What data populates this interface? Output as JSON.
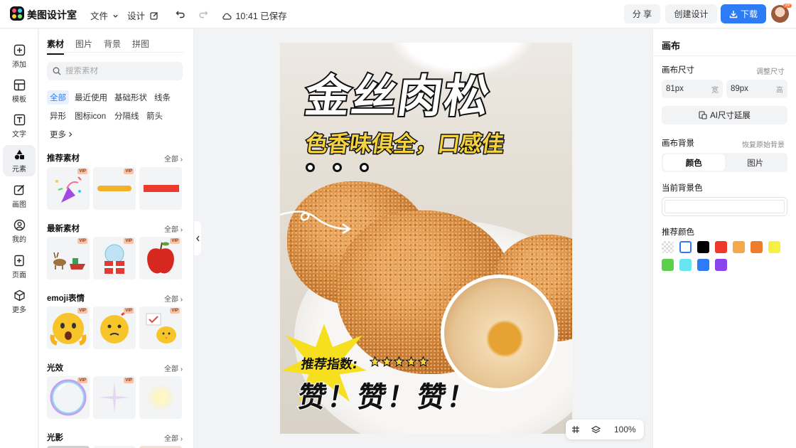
{
  "app": {
    "brand": "美图设计室"
  },
  "topbar": {
    "file_label": "文件",
    "design_label": "设计",
    "save_status": "10:41 已保存",
    "share_label": "分 享",
    "create_label": "创建设计",
    "download_label": "下载",
    "vip_badge": "VIP"
  },
  "rail": {
    "items": [
      {
        "label": "添加",
        "icon": "plus-square-icon"
      },
      {
        "label": "模板",
        "icon": "template-icon"
      },
      {
        "label": "文字",
        "icon": "text-icon"
      },
      {
        "label": "元素",
        "icon": "shapes-icon"
      },
      {
        "label": "画图",
        "icon": "draw-icon"
      },
      {
        "label": "我的",
        "icon": "user-icon"
      },
      {
        "label": "页面",
        "icon": "page-add-icon"
      },
      {
        "label": "更多",
        "icon": "cube-icon"
      }
    ]
  },
  "panel": {
    "tabs": [
      "素材",
      "图片",
      "背景",
      "拼图"
    ],
    "search_placeholder": "搜索素材",
    "chips": [
      "全部",
      "最近使用",
      "基础形状",
      "线条",
      "异形",
      "图标icon",
      "分隔线",
      "箭头",
      "更多"
    ],
    "all_label": "全部",
    "vip": "VIP",
    "sections": [
      "推荐素材",
      "最新素材",
      "emoji表情",
      "光效",
      "光影"
    ]
  },
  "poster": {
    "headline": "金丝肉松",
    "subline": "色香味俱全，口感佳",
    "rating_label": "推荐指数:",
    "rating_stars": 5,
    "praise": "赞！赞！赞！"
  },
  "bottombar": {
    "zoom": "100%"
  },
  "right": {
    "title": "画布",
    "size_label": "画布尺寸",
    "adjust_label": "调整尺寸",
    "width_value": "81px",
    "width_unit": "宽",
    "height_value": "89px",
    "height_unit": "高",
    "ai_extend_label": "AI尺寸延展",
    "bg_label": "画布背景",
    "restore_label": "恢复原始背景",
    "seg_color": "颜色",
    "seg_image": "图片",
    "current_bg_label": "当前背景色",
    "recommended_label": "推荐颜色",
    "swatches": [
      "transparent",
      "#ffffff",
      "#000000",
      "#ee3a2c",
      "#f5a84a",
      "#ef7b2e",
      "#f6f043",
      "#5cd04a",
      "#67e6ef",
      "#2d7cf6",
      "#8a45ee"
    ]
  },
  "colors": {
    "accent": "#2d7cf6",
    "poster_yellow": "#f6d23b"
  }
}
